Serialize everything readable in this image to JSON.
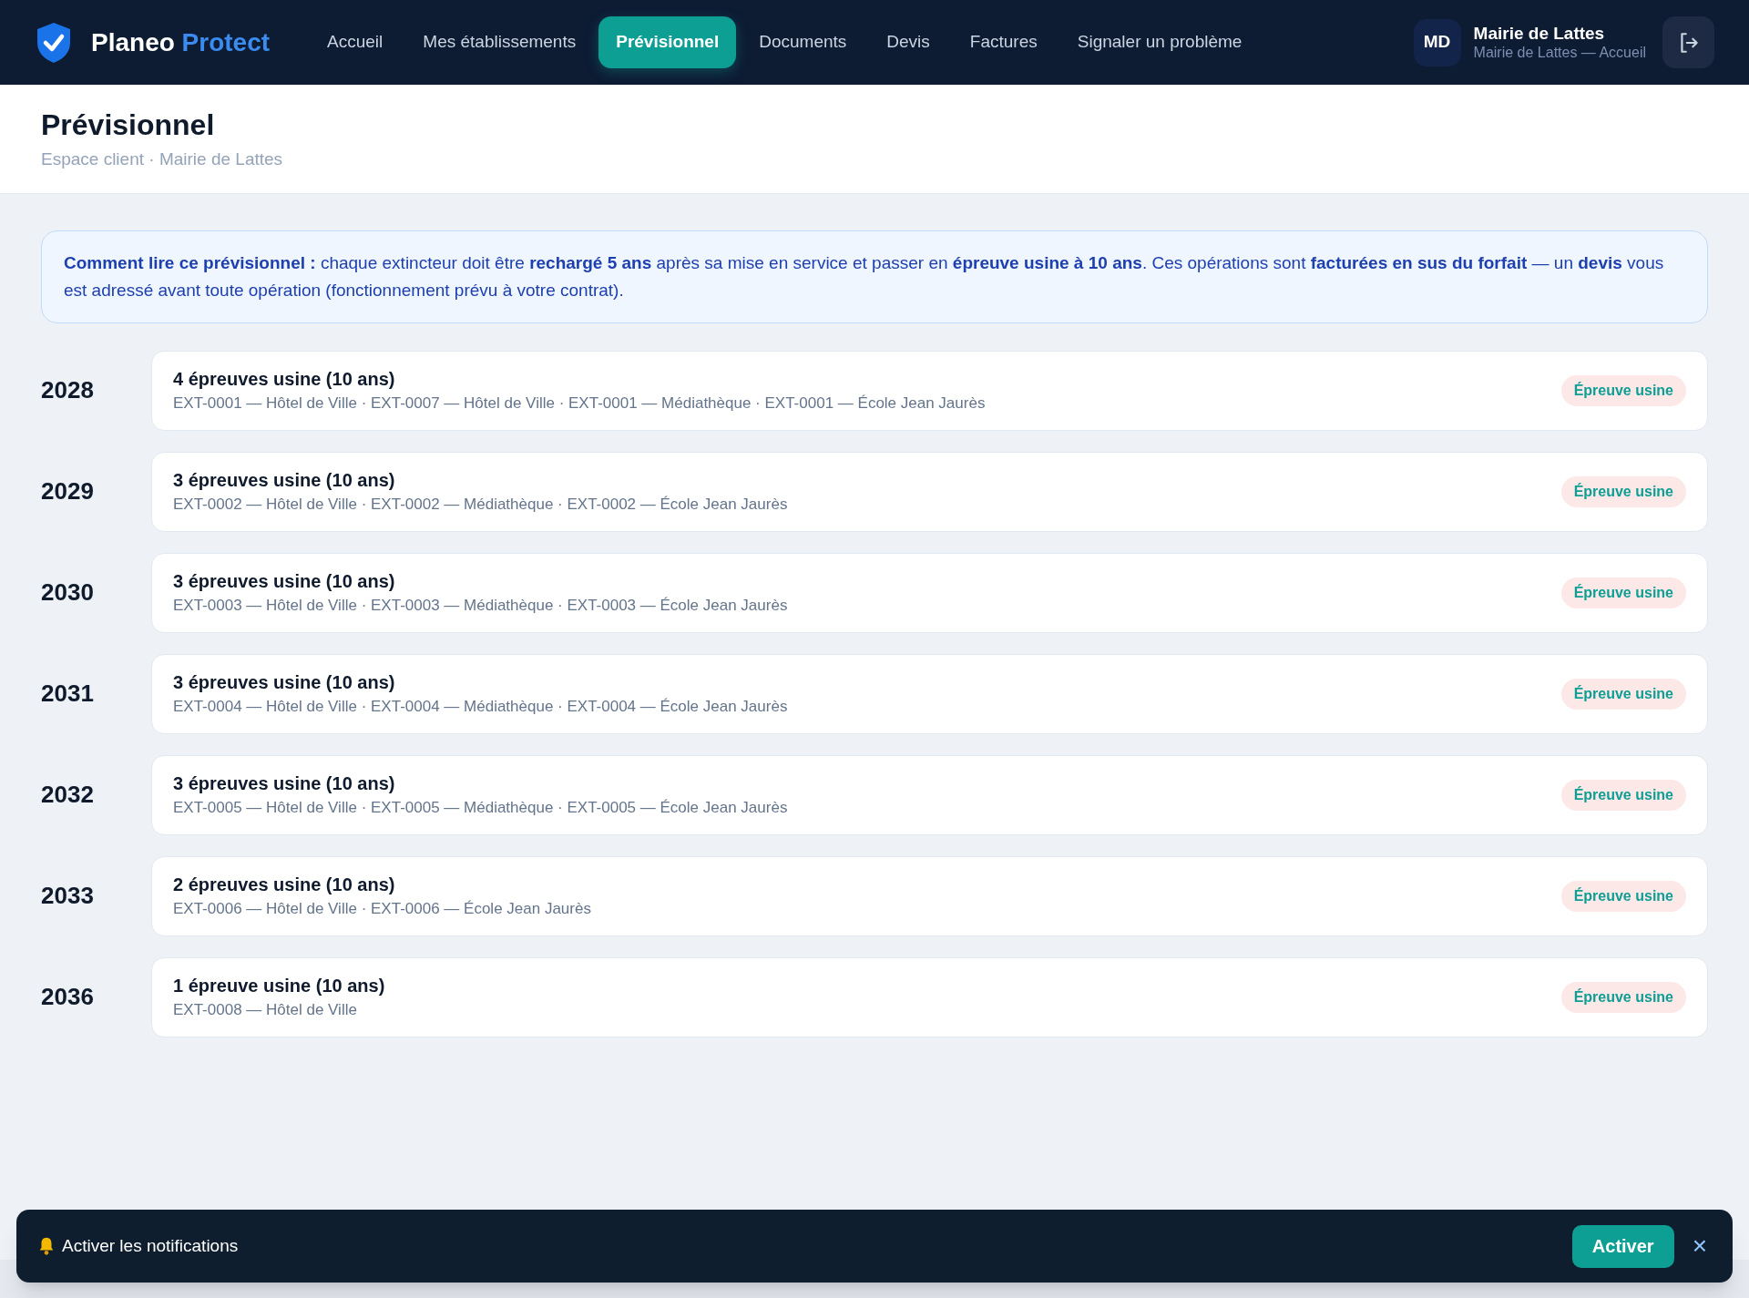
{
  "brand": {
    "name": "Planeo",
    "accent": "Protect"
  },
  "nav": [
    {
      "label": "Accueil",
      "selected": false
    },
    {
      "label": "Mes établissements",
      "selected": false
    },
    {
      "label": "Prévisionnel",
      "selected": true
    },
    {
      "label": "Documents",
      "selected": false
    },
    {
      "label": "Devis",
      "selected": false
    },
    {
      "label": "Factures",
      "selected": false
    },
    {
      "label": "Signaler un problème",
      "selected": false
    }
  ],
  "user": {
    "initials": "MD",
    "name": "Mairie de Lattes",
    "subtitle": "Mairie de Lattes — Accueil"
  },
  "page": {
    "title": "Prévisionnel",
    "breadcrumb": "Espace client · Mairie de Lattes"
  },
  "info": "**Comment lire ce prévisionnel :** chaque extincteur doit être **rechargé 5 ans** après sa mise en service et passer en **épreuve usine à 10 ans**. Ces opérations sont **facturées en sus du forfait** — un **devis** vous est adressé avant toute opération (fonctionnement prévu à votre contrat).",
  "years": [
    {
      "year": "2028",
      "title": "4 épreuves usine (10 ans)",
      "items": "EXT-0001 — Hôtel de Ville · EXT-0007 — Hôtel de Ville · EXT-0001 — Médiathèque · EXT-0001 — École Jean Jaurès",
      "badge": "Épreuve usine"
    },
    {
      "year": "2029",
      "title": "3 épreuves usine (10 ans)",
      "items": "EXT-0002 — Hôtel de Ville · EXT-0002 — Médiathèque · EXT-0002 — École Jean Jaurès",
      "badge": "Épreuve usine"
    },
    {
      "year": "2030",
      "title": "3 épreuves usine (10 ans)",
      "items": "EXT-0003 — Hôtel de Ville · EXT-0003 — Médiathèque · EXT-0003 — École Jean Jaurès",
      "badge": "Épreuve usine"
    },
    {
      "year": "2031",
      "title": "3 épreuves usine (10 ans)",
      "items": "EXT-0004 — Hôtel de Ville · EXT-0004 — Médiathèque · EXT-0004 — École Jean Jaurès",
      "badge": "Épreuve usine"
    },
    {
      "year": "2032",
      "title": "3 épreuves usine (10 ans)",
      "items": "EXT-0005 — Hôtel de Ville · EXT-0005 — Médiathèque · EXT-0005 — École Jean Jaurès",
      "badge": "Épreuve usine"
    },
    {
      "year": "2033",
      "title": "2 épreuves usine (10 ans)",
      "items": "EXT-0006 — Hôtel de Ville · EXT-0006 — École Jean Jaurès",
      "badge": "Épreuve usine"
    },
    {
      "year": "2036",
      "title": "1 épreuve usine (10 ans)",
      "items": "EXT-0008 — Hôtel de Ville",
      "badge": "Épreuve usine"
    }
  ],
  "notification": {
    "text": "Activer les notifications",
    "button": "Activer",
    "close": "×"
  }
}
